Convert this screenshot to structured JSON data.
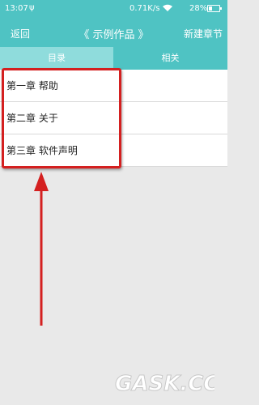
{
  "status_bar": {
    "time": "13:07",
    "usb_icon": "ψ",
    "net_speed": "0.71K/s",
    "wifi_icon": "wifi-icon",
    "battery_pct": "28%",
    "battery_level": 0.28
  },
  "header": {
    "back_label": "返回",
    "title": "《 示例作品 》",
    "new_chapter_label": "新建章节"
  },
  "tabs": [
    {
      "label": "目录",
      "active": true
    },
    {
      "label": "相关",
      "active": false
    }
  ],
  "chapters": [
    {
      "label": "第一章 帮助"
    },
    {
      "label": "第二章 关于"
    },
    {
      "label": "第三章 软件声明"
    }
  ],
  "watermark": {
    "text": "GASK.CC"
  },
  "colors": {
    "accent": "#4fc3c3",
    "active_tab": "#8fdcdc",
    "annotation_red": "#d42020"
  }
}
